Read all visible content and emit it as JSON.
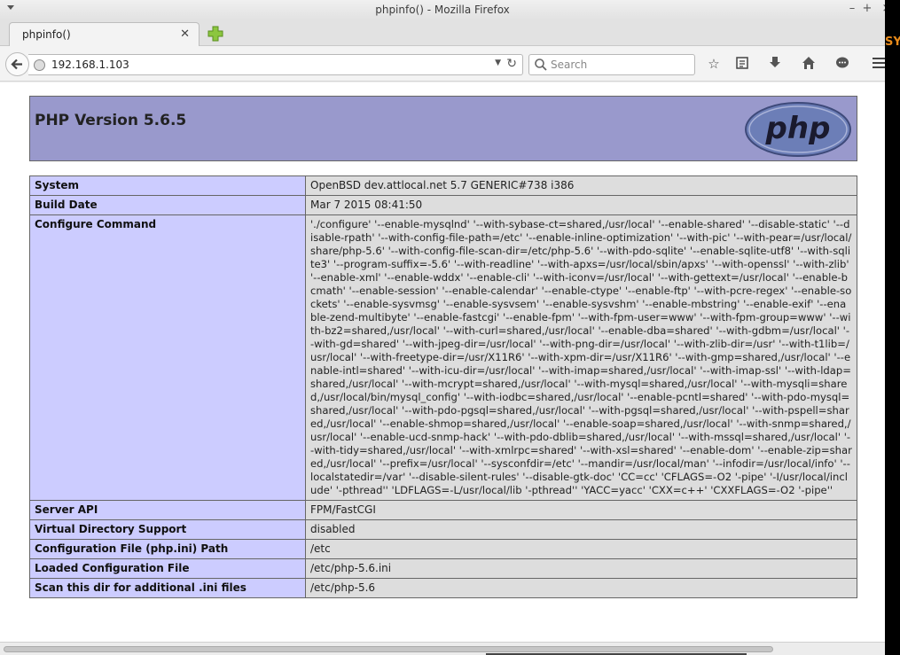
{
  "window": {
    "title": "phpinfo() - Mozilla Firefox"
  },
  "tab": {
    "label": "phpinfo()"
  },
  "nav": {
    "url": "192.168.1.103",
    "search_placeholder": "Search"
  },
  "page": {
    "version_title": "PHP Version 5.6.5",
    "logo_text": "php",
    "rows": [
      {
        "key": "System",
        "value": "OpenBSD dev.attlocal.net 5.7 GENERIC#738 i386"
      },
      {
        "key": "Build Date",
        "value": "Mar 7 2015 08:41:50"
      },
      {
        "key": "Configure Command",
        "value": "'./configure' '--enable-mysqlnd' '--with-sybase-ct=shared,/usr/local' '--enable-shared' '--disable-static' '--disable-rpath' '--with-config-file-path=/etc' '--enable-inline-optimization' '--with-pic' '--with-pear=/usr/local/share/php-5.6' '--with-config-file-scan-dir=/etc/php-5.6' '--with-pdo-sqlite' '--enable-sqlite-utf8' '--with-sqlite3' '--program-suffix=-5.6' '--with-readline' '--with-apxs=/usr/local/sbin/apxs' '--with-openssl' '--with-zlib' '--enable-xml' '--enable-wddx' '--enable-cli' '--with-iconv=/usr/local' '--with-gettext=/usr/local' '--enable-bcmath' '--enable-session' '--enable-calendar' '--enable-ctype' '--enable-ftp' '--with-pcre-regex' '--enable-sockets' '--enable-sysvmsg' '--enable-sysvsem' '--enable-sysvshm' '--enable-mbstring' '--enable-exif' '--enable-zend-multibyte' '--enable-fastcgi' '--enable-fpm' '--with-fpm-user=www' '--with-fpm-group=www' '--with-bz2=shared,/usr/local' '--with-curl=shared,/usr/local' '--enable-dba=shared' '--with-gdbm=/usr/local' '--with-gd=shared' '--with-jpeg-dir=/usr/local' '--with-png-dir=/usr/local' '--with-zlib-dir=/usr' '--with-t1lib=/usr/local' '--with-freetype-dir=/usr/X11R6' '--with-xpm-dir=/usr/X11R6' '--with-gmp=shared,/usr/local' '--enable-intl=shared' '--with-icu-dir=/usr/local' '--with-imap=shared,/usr/local' '--with-imap-ssl' '--with-ldap=shared,/usr/local' '--with-mcrypt=shared,/usr/local' '--with-mysql=shared,/usr/local' '--with-mysqli=shared,/usr/local/bin/mysql_config' '--with-iodbc=shared,/usr/local' '--enable-pcntl=shared' '--with-pdo-mysql=shared,/usr/local' '--with-pdo-pgsql=shared,/usr/local' '--with-pgsql=shared,/usr/local' '--with-pspell=shared,/usr/local' '--enable-shmop=shared,/usr/local' '--enable-soap=shared,/usr/local' '--with-snmp=shared,/usr/local' '--enable-ucd-snmp-hack' '--with-pdo-dblib=shared,/usr/local' '--with-mssql=shared,/usr/local' '--with-tidy=shared,/usr/local' '--with-xmlrpc=shared' '--with-xsl=shared' '--enable-dom' '--enable-zip=shared,/usr/local' '--prefix=/usr/local' '--sysconfdir=/etc' '--mandir=/usr/local/man' '--infodir=/usr/local/info' '--localstatedir=/var' '--disable-silent-rules' '--disable-gtk-doc' 'CC=cc' 'CFLAGS=-O2 '-pipe' '-I/usr/local/include' '-pthread'' 'LDFLAGS=-L/usr/local/lib '-pthread'' 'YACC=yacc' 'CXX=c++' 'CXXFLAGS=-O2 '-pipe''"
      },
      {
        "key": "Server API",
        "value": "FPM/FastCGI"
      },
      {
        "key": "Virtual Directory Support",
        "value": "disabled"
      },
      {
        "key": "Configuration File (php.ini) Path",
        "value": "/etc"
      },
      {
        "key": "Loaded Configuration File",
        "value": "/etc/php-5.6.ini"
      },
      {
        "key": "Scan this dir for additional .ini files",
        "value": "/etc/php-5.6"
      }
    ]
  },
  "edge_text": "SY",
  "colors": {
    "header_bg": "#9999cc",
    "key_bg": "#ccccff",
    "value_bg": "#dddddd"
  }
}
